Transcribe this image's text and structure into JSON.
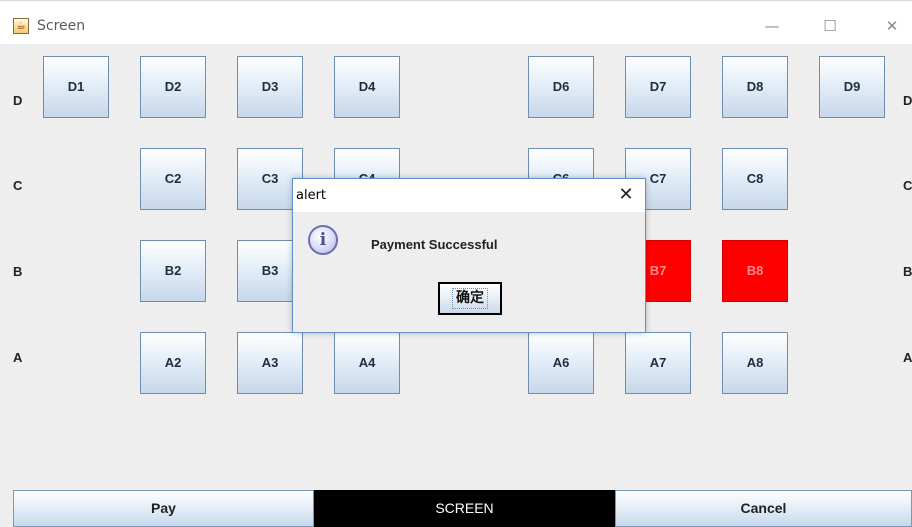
{
  "window": {
    "title": "Screen",
    "icon": "java-cup-icon",
    "controls": {
      "minimize": "—",
      "maximize": "☐",
      "close": "✕"
    }
  },
  "rows": {
    "D": {
      "label": "D",
      "seats": [
        "D1",
        "D2",
        "D3",
        "D4",
        "D6",
        "D7",
        "D8",
        "D9"
      ]
    },
    "C": {
      "label": "C",
      "seats": [
        "C2",
        "C3",
        "C4",
        "C6",
        "C7",
        "C8"
      ]
    },
    "B": {
      "label": "B",
      "seats": [
        "B2",
        "B3",
        "B7",
        "B8"
      ]
    },
    "A": {
      "label": "A",
      "seats": [
        "A2",
        "A3",
        "A4",
        "A6",
        "A7",
        "A8"
      ]
    }
  },
  "seat_status": {
    "sold": [
      "B7",
      "B8"
    ],
    "sold_color": "#ff0000"
  },
  "bottom": {
    "pay_label": "Pay",
    "screen_label": "SCREEN",
    "cancel_label": "Cancel"
  },
  "dialog": {
    "title": "alert",
    "close_glyph": "✕",
    "icon": "info-icon",
    "message": "Payment Successful",
    "ok_label": "确定"
  }
}
